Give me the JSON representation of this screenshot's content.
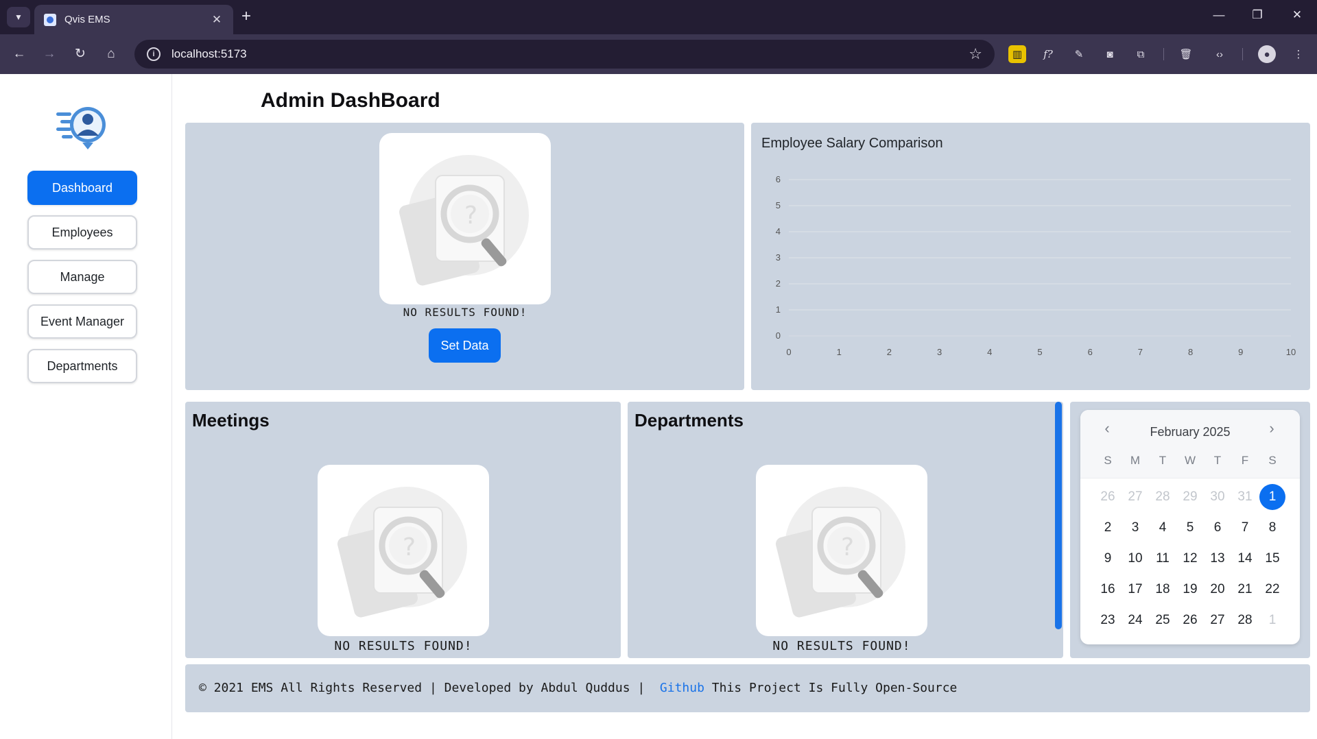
{
  "browser": {
    "tab_title": "Qvis EMS",
    "url": "localhost:5173",
    "new_tab_symbol": "+",
    "close_tab_symbol": "✕"
  },
  "sidebar": {
    "items": [
      {
        "label": "Dashboard",
        "active": true
      },
      {
        "label": "Employees",
        "active": false
      },
      {
        "label": "Manage",
        "active": false
      },
      {
        "label": "Event Manager",
        "active": false
      },
      {
        "label": "Departments",
        "active": false
      }
    ]
  },
  "main": {
    "title": "Admin DashBoard",
    "top_left": {
      "empty_text": "NO RESULTS FOUND!",
      "button_label": "Set Data"
    },
    "chart_panel": {
      "title": "Employee Salary Comparison"
    },
    "meetings": {
      "heading": "Meetings",
      "empty_text": "NO RESULTS FOUND!"
    },
    "departments": {
      "heading": "Departments",
      "empty_text": "NO RESULTS FOUND!"
    },
    "calendar": {
      "month_label": "February 2025",
      "prev_symbol": "‹",
      "next_symbol": "›",
      "weekdays": [
        "S",
        "M",
        "T",
        "W",
        "T",
        "F",
        "S"
      ],
      "weeks": [
        [
          {
            "d": "26",
            "m": true
          },
          {
            "d": "27",
            "m": true
          },
          {
            "d": "28",
            "m": true
          },
          {
            "d": "29",
            "m": true
          },
          {
            "d": "30",
            "m": true
          },
          {
            "d": "31",
            "m": true
          },
          {
            "d": "1",
            "sel": true
          }
        ],
        [
          {
            "d": "2"
          },
          {
            "d": "3"
          },
          {
            "d": "4"
          },
          {
            "d": "5"
          },
          {
            "d": "6"
          },
          {
            "d": "7"
          },
          {
            "d": "8"
          }
        ],
        [
          {
            "d": "9"
          },
          {
            "d": "10"
          },
          {
            "d": "11"
          },
          {
            "d": "12"
          },
          {
            "d": "13"
          },
          {
            "d": "14"
          },
          {
            "d": "15"
          }
        ],
        [
          {
            "d": "16"
          },
          {
            "d": "17"
          },
          {
            "d": "18"
          },
          {
            "d": "19"
          },
          {
            "d": "20"
          },
          {
            "d": "21"
          },
          {
            "d": "22"
          }
        ],
        [
          {
            "d": "23"
          },
          {
            "d": "24"
          },
          {
            "d": "25"
          },
          {
            "d": "26"
          },
          {
            "d": "27"
          },
          {
            "d": "28"
          },
          {
            "d": "1",
            "m": true
          }
        ]
      ],
      "selected_color": "#0b6ff0"
    }
  },
  "footer": {
    "prefix": "© 2021 EMS All Rights Reserved | Developed by Abdul Quddus |  ",
    "link_label": "Github",
    "suffix": " This Project Is Fully Open-Source"
  },
  "colors": {
    "accent": "#0b6ff0",
    "panel_bg": "#cbd4e0",
    "link": "#1a73e8"
  },
  "chart_data": {
    "type": "line",
    "title": "Employee Salary Comparison",
    "xlabel": "",
    "ylabel": "",
    "xlim": [
      0,
      10
    ],
    "ylim": [
      0,
      6
    ],
    "x_ticks": [
      "0",
      "1",
      "2",
      "3",
      "4",
      "5",
      "6",
      "7",
      "8",
      "9",
      "10"
    ],
    "y_ticks": [
      "0",
      "1",
      "2",
      "3",
      "4",
      "5",
      "6"
    ],
    "series": [],
    "grid": true
  }
}
